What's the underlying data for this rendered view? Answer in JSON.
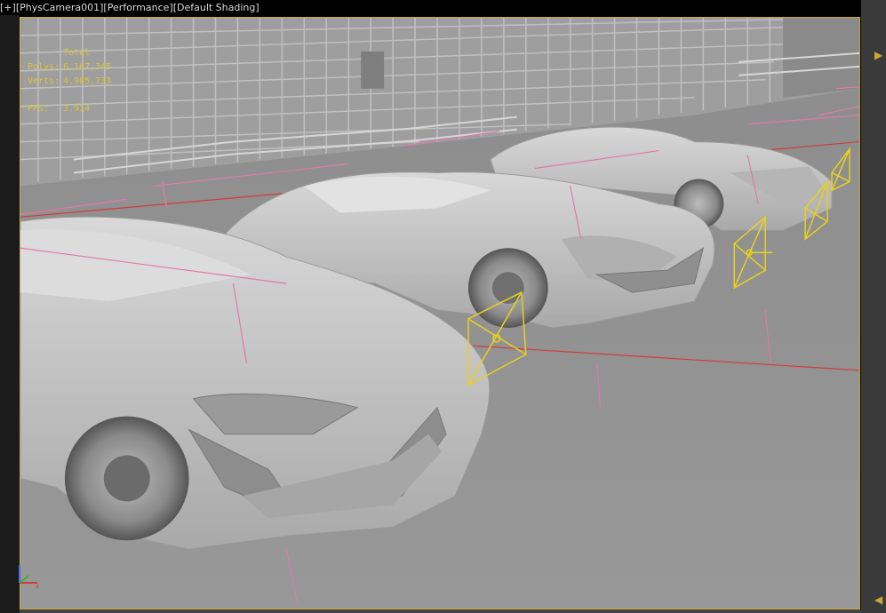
{
  "viewport_label": {
    "plus": "[+]",
    "camera": "[PhysCamera001]",
    "mode": "[Performance]",
    "shading": "[Default Shading]"
  },
  "stats": {
    "total_label": "Total",
    "polys_label": "Polys:",
    "polys_value": "6,167,345",
    "verts_label": "Verts:",
    "verts_value": "4,985,733",
    "fps_label": "FPS:",
    "fps_value": "3.914"
  },
  "colors": {
    "stats_text": "#d9c43a",
    "frame_border": "#c9a83a",
    "gizmo_yellow": "#e8d020",
    "helper_pink": "#e07aa8",
    "horizon_red": "#d23b3b",
    "car_surface": "#c9c9c9",
    "ground": "#8f8f8f"
  },
  "icons": {
    "axis_gizmo": "xyz-axis-icon",
    "scroll_up": "triangle-up-icon",
    "scroll_down": "triangle-down-icon"
  }
}
